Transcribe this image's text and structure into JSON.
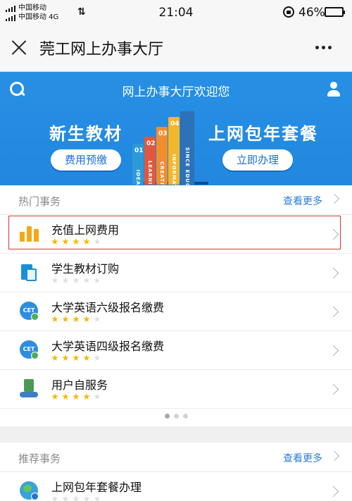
{
  "status_bar": {
    "carrier_1": "中国移动",
    "carrier_2": "中国移动 4G",
    "time": "21:04",
    "battery_percent": "46%",
    "battery_level": 1.0
  },
  "nav": {
    "title": "莞工网上办事大厅"
  },
  "hero": {
    "title": "网上办事大厅欢迎您",
    "banner_left_text": "新生教材",
    "banner_right_text": "上网包年套餐",
    "button_left": "费用预缴",
    "button_right": "立即办理",
    "books": [
      {
        "num": "01",
        "word": "IDEA",
        "color": "#2d9ad8"
      },
      {
        "num": "02",
        "word": "LEARNING",
        "color": "#e2573b"
      },
      {
        "num": "03",
        "word": "CREATIVE",
        "color": "#f08e2e"
      },
      {
        "num": "04",
        "word": "INFORMATION",
        "color": "#f3b72a"
      },
      {
        "num": "",
        "word": "SINCE EDUCATION",
        "color": "#2c72b8"
      }
    ]
  },
  "hot": {
    "title": "热门事务",
    "more": "查看更多",
    "items": [
      {
        "label": "充值上网费用",
        "icon": "bar-chart-icon",
        "rating": 4,
        "highlighted": true
      },
      {
        "label": "学生教材订购",
        "icon": "books-icon",
        "rating": 0,
        "highlighted": false
      },
      {
        "label": "大学英语六级报名缴费",
        "icon": "cet-icon",
        "rating": 4,
        "highlighted": false
      },
      {
        "label": "大学英语四级报名缴费",
        "icon": "cet-icon",
        "rating": 4,
        "highlighted": false
      },
      {
        "label": "用户自服务",
        "icon": "self-service-icon",
        "rating": 4,
        "highlighted": false
      }
    ],
    "page_count": 3,
    "current_page": 1
  },
  "recommend": {
    "title": "推荐事务",
    "more": "查看更多",
    "items": [
      {
        "label": "上网包年套餐办理",
        "icon": "globe-icon",
        "rating": 0
      }
    ]
  }
}
